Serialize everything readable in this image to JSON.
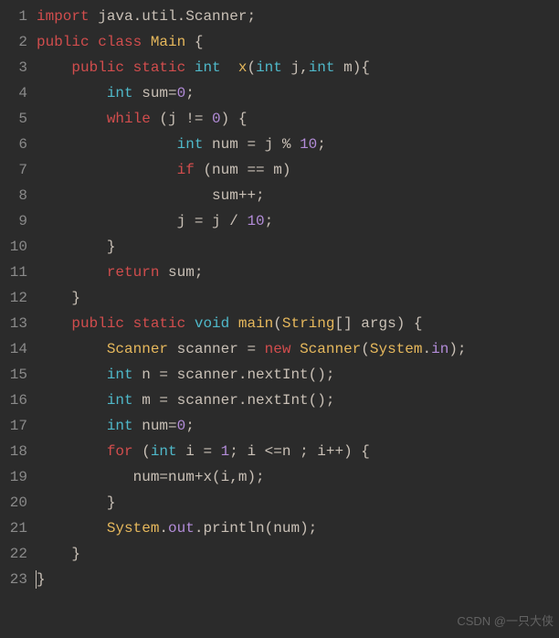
{
  "watermark": "CSDN @一只大侠",
  "lines": [
    {
      "n": 1,
      "indent": "",
      "tokens": [
        [
          "import ",
          "k-import"
        ],
        [
          "java.util.Scanner;",
          "ident"
        ]
      ]
    },
    {
      "n": 2,
      "indent": "",
      "tokens": [
        [
          "public ",
          "k-mod"
        ],
        [
          "class ",
          "k-mod"
        ],
        [
          "Main",
          "name-type"
        ],
        [
          " {",
          "punc"
        ]
      ]
    },
    {
      "n": 3,
      "indent": "    ",
      "tokens": [
        [
          "public ",
          "k-mod"
        ],
        [
          "static ",
          "k-mod"
        ],
        [
          "int",
          "k-type"
        ],
        [
          "  ",
          "punc"
        ],
        [
          "x",
          "fn"
        ],
        [
          "(",
          "punc"
        ],
        [
          "int",
          "k-type"
        ],
        [
          " j,",
          "ident"
        ],
        [
          "int",
          "k-type"
        ],
        [
          " m){",
          "ident"
        ]
      ]
    },
    {
      "n": 4,
      "indent": "        ",
      "tokens": [
        [
          "int",
          "k-type"
        ],
        [
          " sum=",
          "ident"
        ],
        [
          "0",
          "num"
        ],
        [
          ";",
          "punc"
        ]
      ]
    },
    {
      "n": 5,
      "indent": "        ",
      "tokens": [
        [
          "while ",
          "k-ctrl"
        ],
        [
          "(j != ",
          "ident"
        ],
        [
          "0",
          "num"
        ],
        [
          ") {",
          "punc"
        ]
      ]
    },
    {
      "n": 6,
      "indent": "                ",
      "tokens": [
        [
          "int",
          "k-type"
        ],
        [
          " num = j % ",
          "ident"
        ],
        [
          "10",
          "num"
        ],
        [
          ";",
          "punc"
        ]
      ]
    },
    {
      "n": 7,
      "indent": "                ",
      "tokens": [
        [
          "if ",
          "k-ctrl"
        ],
        [
          "(num == m)",
          "ident"
        ]
      ]
    },
    {
      "n": 8,
      "indent": "                    ",
      "tokens": [
        [
          "sum++;",
          "ident"
        ]
      ]
    },
    {
      "n": 9,
      "indent": "                ",
      "tokens": [
        [
          "j = j / ",
          "ident"
        ],
        [
          "10",
          "num"
        ],
        [
          ";",
          "punc"
        ]
      ]
    },
    {
      "n": 10,
      "indent": "        ",
      "tokens": [
        [
          "}",
          "punc"
        ]
      ]
    },
    {
      "n": 11,
      "indent": "        ",
      "tokens": [
        [
          "return ",
          "k-mod"
        ],
        [
          "sum;",
          "ident"
        ]
      ]
    },
    {
      "n": 12,
      "indent": "    ",
      "tokens": [
        [
          "}",
          "punc"
        ]
      ]
    },
    {
      "n": 13,
      "indent": "    ",
      "tokens": [
        [
          "public ",
          "k-mod"
        ],
        [
          "static ",
          "k-mod"
        ],
        [
          "void ",
          "k-type"
        ],
        [
          "main",
          "fn"
        ],
        [
          "(",
          "punc"
        ],
        [
          "String",
          "name-type"
        ],
        [
          "[] args) {",
          "ident"
        ]
      ]
    },
    {
      "n": 14,
      "indent": "        ",
      "tokens": [
        [
          "Scanner",
          "name-type"
        ],
        [
          " scanner = ",
          "ident"
        ],
        [
          "new ",
          "k-new"
        ],
        [
          "Scanner",
          "name-type"
        ],
        [
          "(",
          "punc"
        ],
        [
          "System",
          "name-type"
        ],
        [
          ".",
          "punc"
        ],
        [
          "in",
          "field"
        ],
        [
          ");",
          "punc"
        ]
      ]
    },
    {
      "n": 15,
      "indent": "        ",
      "tokens": [
        [
          "int",
          "k-type"
        ],
        [
          " n = scanner.nextInt();",
          "ident"
        ]
      ]
    },
    {
      "n": 16,
      "indent": "        ",
      "tokens": [
        [
          "int",
          "k-type"
        ],
        [
          " m = scanner.nextInt();",
          "ident"
        ]
      ]
    },
    {
      "n": 17,
      "indent": "        ",
      "tokens": [
        [
          "int",
          "k-type"
        ],
        [
          " num=",
          "ident"
        ],
        [
          "0",
          "num"
        ],
        [
          ";",
          "punc"
        ]
      ]
    },
    {
      "n": 18,
      "indent": "        ",
      "tokens": [
        [
          "for ",
          "k-ctrl"
        ],
        [
          "(",
          "punc"
        ],
        [
          "int",
          "k-type"
        ],
        [
          " i = ",
          "ident"
        ],
        [
          "1",
          "num"
        ],
        [
          "; i <=n ; i++) {",
          "ident"
        ]
      ]
    },
    {
      "n": 19,
      "indent": "           ",
      "tokens": [
        [
          "num=num+x(i,m);",
          "ident"
        ]
      ]
    },
    {
      "n": 20,
      "indent": "        ",
      "tokens": [
        [
          "}",
          "punc"
        ]
      ]
    },
    {
      "n": 21,
      "indent": "        ",
      "tokens": [
        [
          "System",
          "name-type"
        ],
        [
          ".",
          "punc"
        ],
        [
          "out",
          "field"
        ],
        [
          ".println(num);",
          "ident"
        ]
      ]
    },
    {
      "n": 22,
      "indent": "    ",
      "tokens": [
        [
          "}",
          "punc"
        ]
      ]
    },
    {
      "n": 23,
      "indent": "",
      "tokens": [
        [
          "}",
          "punc"
        ]
      ],
      "cursor": true
    }
  ]
}
